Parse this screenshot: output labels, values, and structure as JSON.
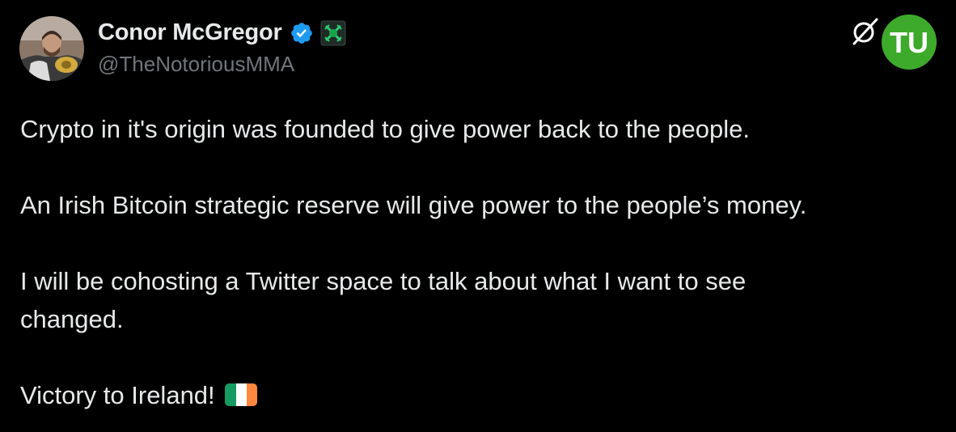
{
  "author": {
    "display_name": "Conor McGregor",
    "handle": "@TheNotoriousMMA",
    "avatar_icon": "profile-photo",
    "verified_icon": "verified-badge-icon",
    "verified_color": "#1d9bf0",
    "affiliation_icon": "affiliate-badge-icon"
  },
  "brand_logo": {
    "text": "TU",
    "icon": "brand-logo-icon",
    "bg_color": "#3eaa2b"
  },
  "tweet": {
    "paragraphs": [
      "Crypto in it's origin was founded to give power back to the people.",
      "An Irish Bitcoin strategic reserve will give power to the people’s money.",
      "I will be cohosting a Twitter space to talk about what I want to see\nchanged."
    ],
    "last_line": "Victory to Ireland!",
    "flag_icon": "ireland-flag-icon",
    "flag_colors": [
      "#169b62",
      "#ffffff",
      "#ff883e"
    ]
  },
  "colors": {
    "background": "#000000",
    "text": "#e7e9ea",
    "secondary_text": "#71767b"
  }
}
